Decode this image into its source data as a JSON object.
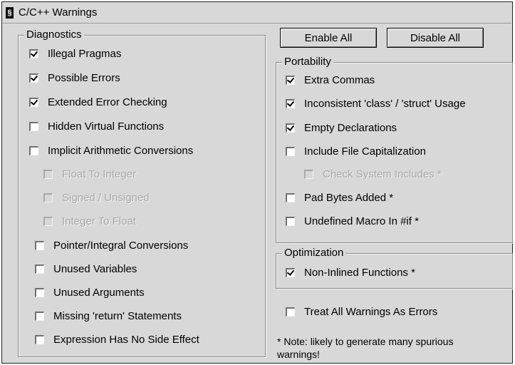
{
  "window": {
    "title": "C/C++ Warnings"
  },
  "buttons": {
    "enable_all": "Enable All",
    "disable_all": "Disable All"
  },
  "diagnostics": {
    "label": "Diagnostics",
    "items": [
      {
        "label": "Illegal Pragmas",
        "checked": true,
        "enabled": true
      },
      {
        "label": "Possible Errors",
        "checked": true,
        "enabled": true
      },
      {
        "label": "Extended Error Checking",
        "checked": true,
        "enabled": true
      },
      {
        "label": "Hidden Virtual Functions",
        "checked": false,
        "enabled": true
      },
      {
        "label": "Implicit Arithmetic Conversions",
        "checked": false,
        "enabled": true
      },
      {
        "label": "Float To Integer",
        "checked": false,
        "enabled": false
      },
      {
        "label": "Signed / Unsigned",
        "checked": false,
        "enabled": false
      },
      {
        "label": "Integer To Float",
        "checked": false,
        "enabled": false
      },
      {
        "label": "Pointer/Integral Conversions",
        "checked": false,
        "enabled": true
      },
      {
        "label": "Unused Variables",
        "checked": false,
        "enabled": true
      },
      {
        "label": "Unused Arguments",
        "checked": false,
        "enabled": true
      },
      {
        "label": "Missing 'return' Statements",
        "checked": false,
        "enabled": true
      },
      {
        "label": "Expression Has No Side Effect",
        "checked": false,
        "enabled": true
      }
    ]
  },
  "portability": {
    "label": "Portability",
    "items": [
      {
        "label": "Extra Commas",
        "checked": true,
        "enabled": true
      },
      {
        "label": "Inconsistent 'class' / 'struct' Usage",
        "checked": true,
        "enabled": true
      },
      {
        "label": "Empty Declarations",
        "checked": true,
        "enabled": true
      },
      {
        "label": "Include File Capitalization",
        "checked": false,
        "enabled": true
      },
      {
        "label": "Check System Includes *",
        "checked": false,
        "enabled": false
      },
      {
        "label": "Pad Bytes Added *",
        "checked": false,
        "enabled": true
      },
      {
        "label": "Undefined Macro In #if *",
        "checked": false,
        "enabled": true
      }
    ]
  },
  "optimization": {
    "label": "Optimization",
    "items": [
      {
        "label": "Non-Inlined Functions *",
        "checked": true,
        "enabled": true
      }
    ]
  },
  "treat_as_errors": {
    "label": "Treat All Warnings As Errors",
    "checked": false,
    "enabled": true
  },
  "note": "* Note: likely to generate many spurious warnings!"
}
